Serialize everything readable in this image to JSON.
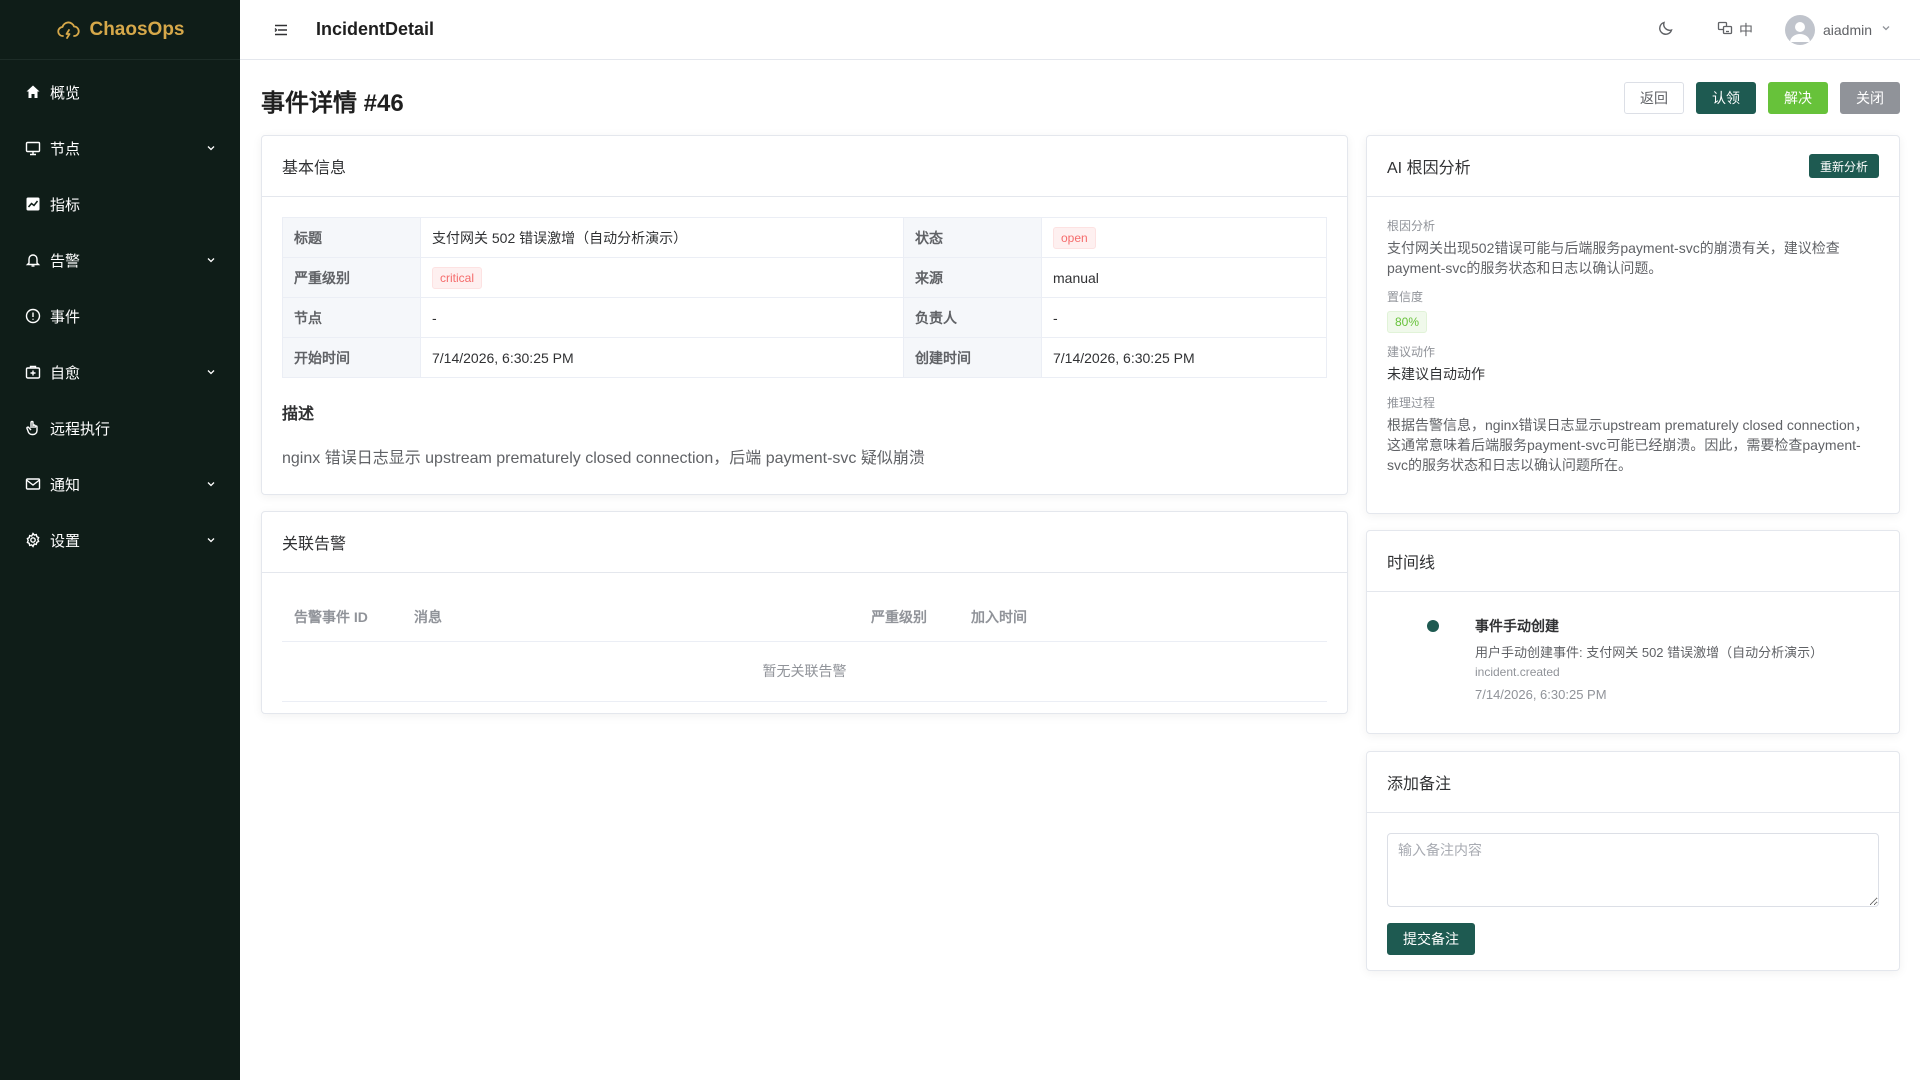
{
  "app": {
    "name": "ChaosOps"
  },
  "sidebar": {
    "items": [
      {
        "label": "概览",
        "icon": "home-icon",
        "expandable": false
      },
      {
        "label": "节点",
        "icon": "monitor-icon",
        "expandable": true
      },
      {
        "label": "指标",
        "icon": "chart-icon",
        "expandable": false
      },
      {
        "label": "告警",
        "icon": "bell-icon",
        "expandable": true
      },
      {
        "label": "事件",
        "icon": "warning-circle-icon",
        "expandable": false
      },
      {
        "label": "自愈",
        "icon": "first-aid-icon",
        "expandable": true
      },
      {
        "label": "远程执行",
        "icon": "hand-icon",
        "expandable": false
      },
      {
        "label": "通知",
        "icon": "mail-icon",
        "expandable": true
      },
      {
        "label": "设置",
        "icon": "gear-icon",
        "expandable": true
      }
    ]
  },
  "header": {
    "route": "IncidentDetail",
    "lang": "中",
    "username": "aiadmin"
  },
  "page": {
    "title": "事件详情 #46",
    "buttons": {
      "back": "返回",
      "claim": "认领",
      "resolve": "解决",
      "close": "关闭"
    }
  },
  "basic": {
    "card_title": "基本信息",
    "rows": [
      {
        "l1": "标题",
        "v1": "支付网关 502 错误激增（自动分析演示）",
        "l2": "状态",
        "v2": "open"
      },
      {
        "l1": "严重级别",
        "v1": "critical",
        "l2": "来源",
        "v2": "manual"
      },
      {
        "l1": "节点",
        "v1": "-",
        "l2": "负责人",
        "v2": "-"
      },
      {
        "l1": "开始时间",
        "v1": "7/14/2026, 6:30:25 PM",
        "l2": "创建时间",
        "v2": "7/14/2026, 6:30:25 PM"
      }
    ],
    "desc_title": "描述",
    "desc_text": "nginx 错误日志显示 upstream prematurely closed connection，后端 payment-svc 疑似崩溃"
  },
  "alerts": {
    "card_title": "关联告警",
    "columns": [
      "告警事件 ID",
      "消息",
      "严重级别",
      "加入时间"
    ],
    "empty_text": "暂无关联告警"
  },
  "ai": {
    "card_title": "AI 根因分析",
    "reanalyze": "重新分析",
    "root_cause_label": "根因分析",
    "root_cause": "支付网关出现502错误可能与后端服务payment-svc的崩溃有关，建议检查payment-svc的服务状态和日志以确认问题。",
    "confidence_label": "置信度",
    "confidence": "80%",
    "action_label": "建议动作",
    "action": "未建议自动动作",
    "reasoning_label": "推理过程",
    "reasoning": "根据告警信息，nginx错误日志显示upstream prematurely closed connection，这通常意味着后端服务payment-svc可能已经崩溃。因此，需要检查payment-svc的服务状态和日志以确认问题所在。"
  },
  "timeline": {
    "card_title": "时间线",
    "items": [
      {
        "title": "事件手动创建",
        "desc": "用户手动创建事件: 支付网关 502 错误激增（自动分析演示）",
        "code": "incident.created",
        "time": "7/14/2026, 6:30:25 PM"
      }
    ]
  },
  "note": {
    "card_title": "添加备注",
    "placeholder": "输入备注内容",
    "submit": "提交备注"
  },
  "colors": {
    "sidebar_bg": "#0f1d18",
    "brand": "#d6a84a",
    "primary": "#1e5a51",
    "success": "#67c23a",
    "info": "#909399",
    "danger": "#f56c6c"
  }
}
